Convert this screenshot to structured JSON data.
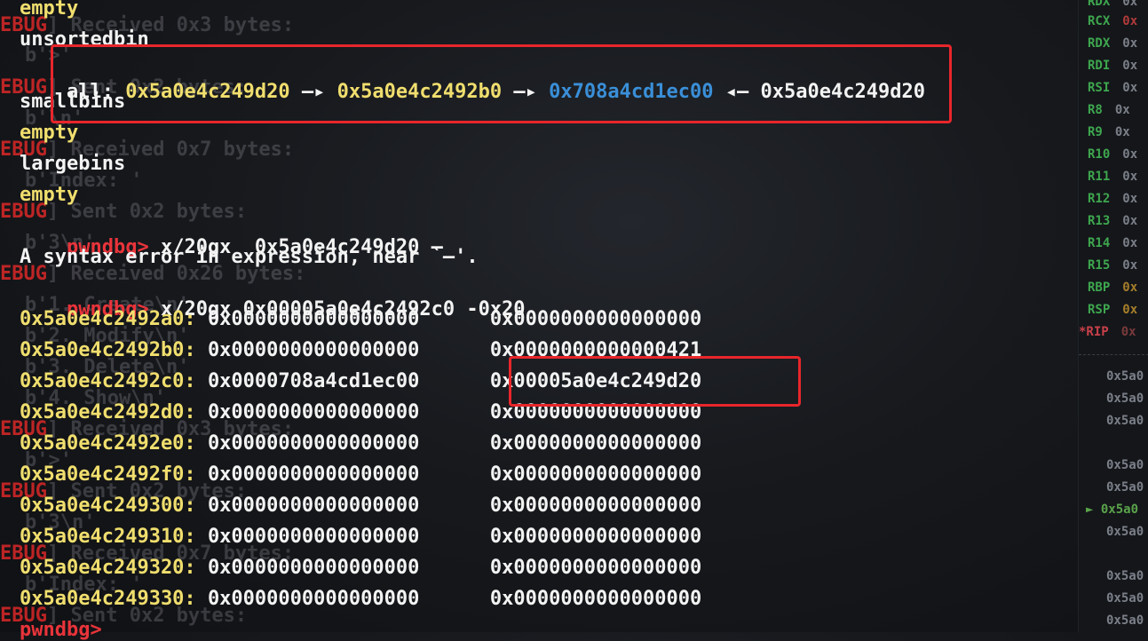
{
  "ghost_lines": [
    {
      "prefix": "EBUG",
      "text": "] Received 0x3 bytes:"
    },
    {
      "prefix": "",
      "text": "b'>'"
    },
    {
      "prefix": "EBUG",
      "text": "] Sent 0x2 bytes:"
    },
    {
      "prefix": "",
      "text": "b'\\n'"
    },
    {
      "prefix": "EBUG",
      "text": "] Received 0x7 bytes:"
    },
    {
      "prefix": "",
      "text": "b'Index: '"
    },
    {
      "prefix": "EBUG",
      "text": "] Sent 0x2 bytes:"
    },
    {
      "prefix": "",
      "text": "b'3\\n'"
    },
    {
      "prefix": "EBUG",
      "text": "] Received 0x26 bytes:"
    },
    {
      "prefix": "",
      "text": "b'1. Create\\n'"
    },
    {
      "prefix": "",
      "text": "b'2. Modify\\n'"
    },
    {
      "prefix": "",
      "text": "b'3. Delete\\n'"
    },
    {
      "prefix": "",
      "text": "b'4. Show\\n'"
    },
    {
      "prefix": "EBUG",
      "text": "] Received 0x3 bytes:"
    },
    {
      "prefix": "",
      "text": "b'>'"
    },
    {
      "prefix": "EBUG",
      "text": "] Sent 0x2 bytes:"
    },
    {
      "prefix": "",
      "text": "b'3\\n'"
    },
    {
      "prefix": "EBUG",
      "text": "] Received 0x7 bytes:"
    },
    {
      "prefix": "",
      "text": "b'Index: '"
    },
    {
      "prefix": "EBUG",
      "text": "] Sent 0x2 bytes:"
    }
  ],
  "bins": {
    "top_empty": "empty",
    "unsortedbin": "unsortedbin",
    "all_label": "all",
    "all_colon": ":",
    "chain": {
      "a": "0x5a0e4c249d20",
      "arrow1": "—▸",
      "b": "0x5a0e4c2492b0",
      "arrow2": "—▸",
      "c": "0x708a4cd1ec00",
      "arrow3": "◂—",
      "d": "0x5a0e4c249d20"
    },
    "smallbins": "smallbins",
    "smallbins_empty": "empty",
    "largebins": "largebins",
    "largebins_empty": "empty"
  },
  "commands": {
    "prompt": "pwndbg>",
    "cmd1": "x/20gx  0x5a0e4c249d20 —",
    "error": "A syntax error in expression, near `—'.",
    "cmd2": "x/20gx 0x00005a0e4c2492c0 -0x20",
    "last_prompt": "pwndbg>"
  },
  "memory_rows": [
    {
      "addr": "0x5a0e4c2492a0:",
      "q1": "0x0000000000000000",
      "q2": "0x0000000000000000"
    },
    {
      "addr": "0x5a0e4c2492b0:",
      "q1": "0x0000000000000000",
      "q2": "0x0000000000000421"
    },
    {
      "addr": "0x5a0e4c2492c0:",
      "q1": "0x0000708a4cd1ec00",
      "q2": "0x00005a0e4c249d20"
    },
    {
      "addr": "0x5a0e4c2492d0:",
      "q1": "0x0000000000000000",
      "q2": "0x0000000000000000"
    },
    {
      "addr": "0x5a0e4c2492e0:",
      "q1": "0x0000000000000000",
      "q2": "0x0000000000000000"
    },
    {
      "addr": "0x5a0e4c2492f0:",
      "q1": "0x0000000000000000",
      "q2": "0x0000000000000000"
    },
    {
      "addr": "0x5a0e4c249300:",
      "q1": "0x0000000000000000",
      "q2": "0x0000000000000000"
    },
    {
      "addr": "0x5a0e4c249310:",
      "q1": "0x0000000000000000",
      "q2": "0x0000000000000000"
    },
    {
      "addr": "0x5a0e4c249320:",
      "q1": "0x0000000000000000",
      "q2": "0x0000000000000000"
    },
    {
      "addr": "0x5a0e4c249330:",
      "q1": "0x0000000000000000",
      "q2": "0x0000000000000000"
    }
  ],
  "registers": [
    {
      "name": "RDX",
      "val": "0x",
      "style": "v"
    },
    {
      "name": "RCX",
      "val": "0x",
      "style": "v"
    },
    {
      "name": "RDX",
      "val": "0x",
      "style": "v"
    },
    {
      "name": "RDI",
      "val": "0x",
      "style": "v"
    },
    {
      "name": "RSI",
      "val": "0x",
      "style": "v"
    },
    {
      "name": "R8",
      "val": "0x",
      "style": "v"
    },
    {
      "name": "R9",
      "val": "0x",
      "style": "v"
    },
    {
      "name": "R10",
      "val": "0x",
      "style": "v"
    },
    {
      "name": "R11",
      "val": "0x",
      "style": "v"
    },
    {
      "name": "R12",
      "val": "0x",
      "style": "v"
    },
    {
      "name": "R13",
      "val": "0x",
      "style": "v"
    },
    {
      "name": "R14",
      "val": "0x",
      "style": "v"
    },
    {
      "name": "R15",
      "val": "0x",
      "style": "v"
    },
    {
      "name": "RBP",
      "val": "0x",
      "style": "o"
    },
    {
      "name": "RSP",
      "val": "0x",
      "style": "o"
    },
    {
      "name": "*RIP",
      "val": "0x",
      "style": "o"
    }
  ],
  "disasm": [
    {
      "text": "0x5a0"
    },
    {
      "text": "0x5a0"
    },
    {
      "text": "0x5a0"
    },
    {
      "text": ""
    },
    {
      "text": "0x5a0"
    },
    {
      "text": "0x5a0"
    },
    {
      "text": "► 0x5a0"
    },
    {
      "text": "0x5a0"
    },
    {
      "text": ""
    },
    {
      "text": "0x5a0"
    },
    {
      "text": "0x5a0"
    },
    {
      "text": "0x5a0"
    }
  ],
  "colors": {
    "highlight_box": "#e8262b",
    "address_yellow": "#f0de6e",
    "libc_blue": "#3a8fd8",
    "prompt_red": "#e8343a",
    "register_green": "#3ea64e"
  }
}
